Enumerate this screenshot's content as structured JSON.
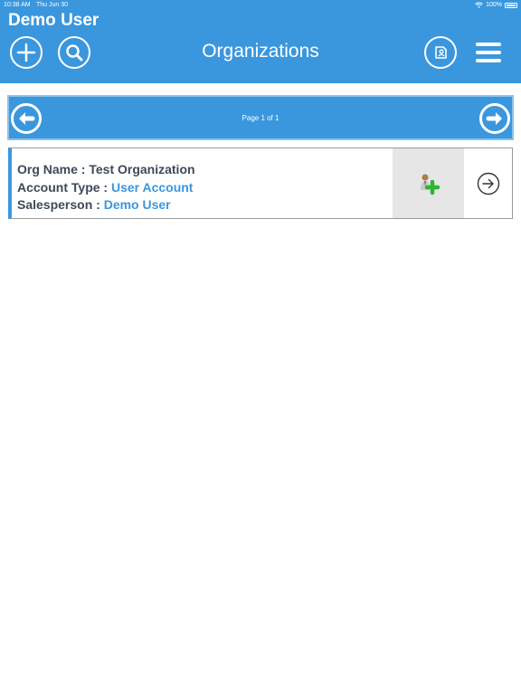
{
  "status": {
    "time": "10:38 AM",
    "date": "Thu Jun 30",
    "battery": "100%"
  },
  "header": {
    "user_name": "Demo User",
    "title": "Organizations"
  },
  "icons": {
    "add": "plus-icon",
    "search": "search-icon",
    "contact": "contact-card-icon",
    "menu": "hamburger-menu-icon",
    "prev": "arrow-left-icon",
    "next": "arrow-right-icon",
    "add_user": "add-user-icon",
    "go": "arrow-right-circle-icon"
  },
  "pager": {
    "text": "Page 1 of 1"
  },
  "organizations": [
    {
      "org_name_label": "Org Name : ",
      "org_name": "Test Organization",
      "account_type_label": "Account Type : ",
      "account_type": "User Account",
      "salesperson_label": "Salesperson : ",
      "salesperson": "Demo User"
    }
  ],
  "colors": {
    "header": "#3a97dd",
    "text_dark": "#3c4a5a",
    "accent": "#3a97dd"
  }
}
